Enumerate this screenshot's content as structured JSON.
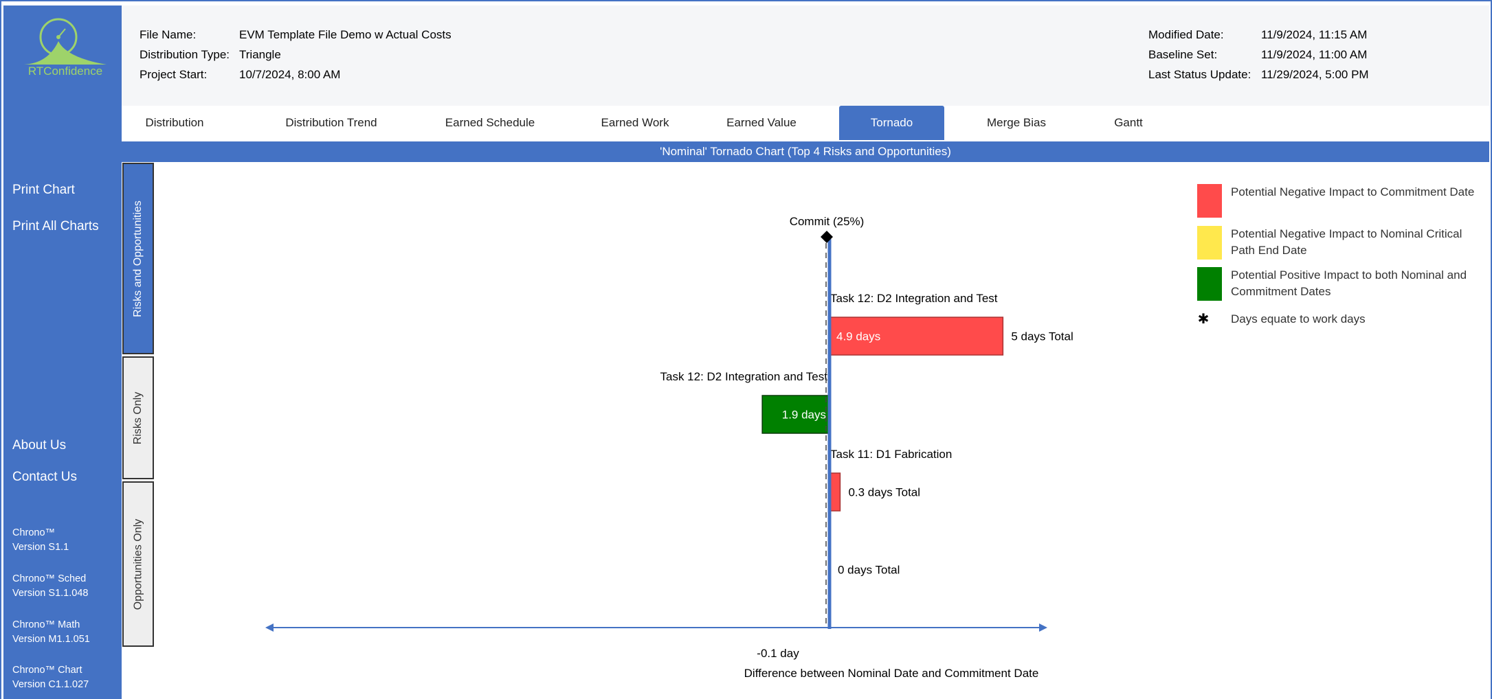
{
  "app": {
    "logo_text": "RTConfidence"
  },
  "sidebar": {
    "print_chart": "Print Chart",
    "print_all_charts": "Print All Charts",
    "about_us": "About Us",
    "contact_us": "Contact Us",
    "versions": [
      {
        "name": "Chrono™",
        "version": "Version S1.1"
      },
      {
        "name": "Chrono™ Sched",
        "version": "Version S1.1.048"
      },
      {
        "name": "Chrono™ Math",
        "version": "Version M1.1.051"
      },
      {
        "name": "Chrono™ Chart",
        "version": "Version C1.1.027"
      }
    ]
  },
  "header": {
    "file_name_label": "File Name:",
    "file_name": "EVM Template File Demo w Actual Costs",
    "distribution_type_label": "Distribution Type:",
    "distribution_type": "Triangle",
    "project_start_label": "Project Start:",
    "project_start": "10/7/2024, 8:00 AM",
    "modified_date_label": "Modified Date:",
    "modified_date": "11/9/2024, 11:15 AM",
    "baseline_set_label": "Baseline Set:",
    "baseline_set": "11/9/2024, 11:00 AM",
    "last_status_label": "Last Status Update:",
    "last_status": "11/29/2024, 5:00 PM"
  },
  "tabs": [
    "Distribution",
    "Distribution Trend",
    "Earned Schedule",
    "Earned Work",
    "Earned Value",
    "Tornado",
    "Merge Bias",
    "Gantt"
  ],
  "active_tab": "Tornado",
  "chart_title": "'Nominal' Tornado Chart (Top 4 Risks and Opportunities)",
  "side_tabs": [
    "Risks and Opportunities",
    "Risks Only",
    "Opportunities Only"
  ],
  "active_side_tab": "Risks and Opportunities",
  "legend": [
    {
      "color": "#ff4b4b",
      "label": "Potential Negative Impact to Commitment Date"
    },
    {
      "color": "#ffe84d",
      "label": "Potential Negative Impact to Nominal Critical Path End Date"
    },
    {
      "color": "#008000",
      "label": "Potential Positive Impact to both Nominal and Commitment Dates"
    },
    {
      "icon": "asterisk-icon",
      "label": "Days equate to work days"
    }
  ],
  "chart_data": {
    "type": "bar",
    "orientation": "horizontal",
    "title": "'Nominal' Tornado Chart (Top 4 Risks and Opportunities)",
    "xlabel": "Difference between Nominal Date and Commitment Date",
    "x_tick": "-0.1 day",
    "commit_label": "Commit (25%)",
    "colors": {
      "risk": "#ff4b4b",
      "opportunity": "#008000"
    },
    "rows": [
      {
        "task": "Task 12: D2 Integration and Test",
        "kind": "risk",
        "value": 4.9,
        "bar_label": "4.9 days",
        "total_label": "5 days Total"
      },
      {
        "task": "Task 12: D2 Integration and Test",
        "kind": "opportunity",
        "value": -1.9,
        "bar_label": "1.9 days",
        "total_label": ""
      },
      {
        "task": "Task 11: D1 Fabrication",
        "kind": "risk",
        "value": 0.3,
        "bar_label": "",
        "total_label": "0.3 days Total"
      },
      {
        "task": "",
        "kind": "risk",
        "value": 0,
        "bar_label": "",
        "total_label": "0 days Total"
      }
    ]
  }
}
